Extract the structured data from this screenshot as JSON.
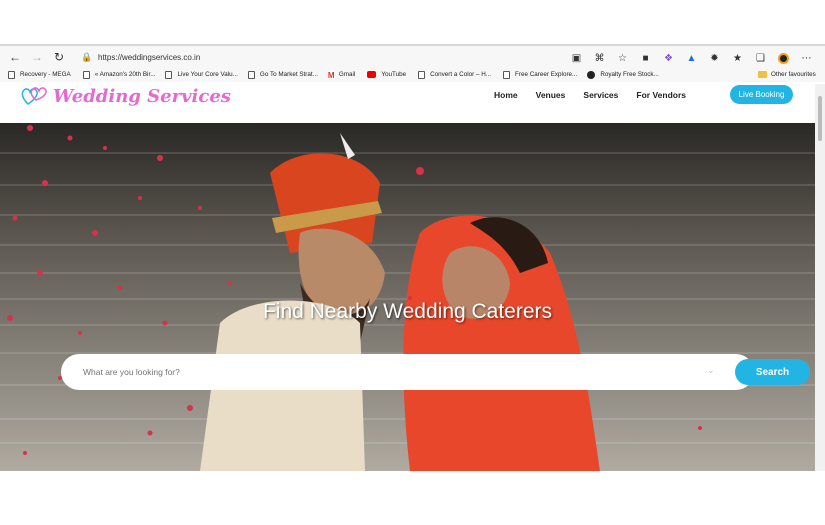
{
  "browser": {
    "url": "https://weddingservices.co.in",
    "bookmarks": [
      {
        "label": "Recovery - MEGA",
        "icon": "page-icon"
      },
      {
        "label": "« Amazon's 20th Bir...",
        "icon": "page-icon"
      },
      {
        "label": "Live Your Core Valu...",
        "icon": "page-icon"
      },
      {
        "label": "Go To Market Strat...",
        "icon": "page-icon"
      },
      {
        "label": "Gmail",
        "icon": "gmail-icon"
      },
      {
        "label": "YouTube",
        "icon": "youtube-icon"
      },
      {
        "label": "Convert a Color – H...",
        "icon": "page-icon"
      },
      {
        "label": "Free Career Explore...",
        "icon": "page-icon"
      },
      {
        "label": "Royalty Free Stock...",
        "icon": "royalty-icon"
      }
    ],
    "other_favourites": "Other favourites"
  },
  "site": {
    "brand": "Wedding Services",
    "nav": [
      "Home",
      "Venues",
      "Services",
      "For Vendors"
    ],
    "cta": "Live Booking"
  },
  "hero": {
    "heading": "Find Nearby Wedding Caterers",
    "search_placeholder": "What are you looking for?",
    "search_button": "Search"
  },
  "colors": {
    "accent": "#22b5e3",
    "brand_pink": "#e26ad2"
  }
}
